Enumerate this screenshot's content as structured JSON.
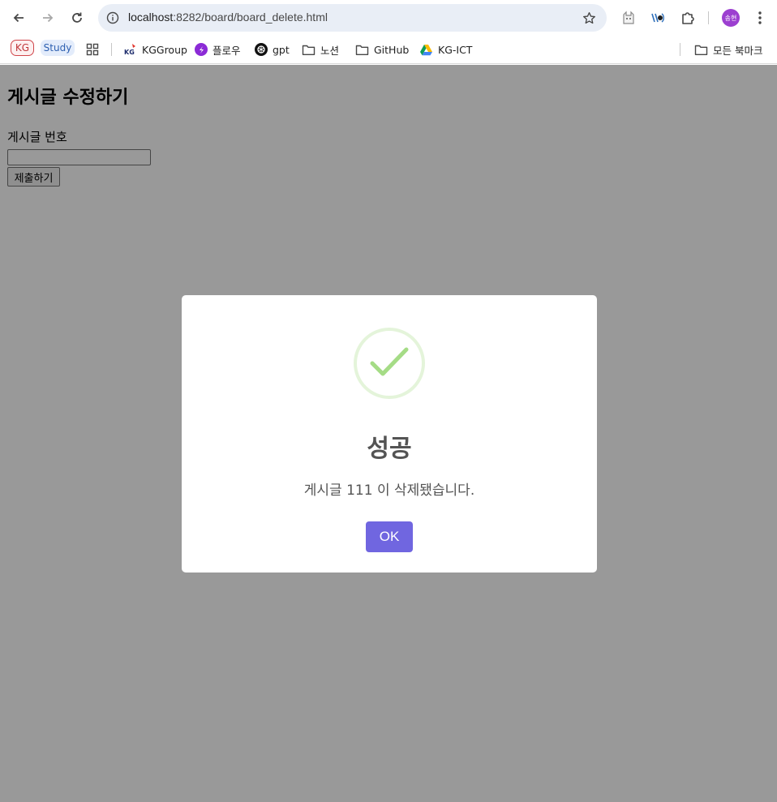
{
  "browser": {
    "url_host": "localhost",
    "url_rest": ":8282/board/board_delete.html",
    "profile_initials": "송현"
  },
  "bookmarks": {
    "kg_chip": "KG",
    "study_chip": "Study",
    "items": [
      "KGGroup",
      "플로우",
      "gpt",
      "노션",
      "GitHub",
      "KG-ICT"
    ],
    "all_bookmarks": "모든 북마크"
  },
  "page": {
    "heading": "게시글 수정하기",
    "label": "게시글 번호",
    "input_value": "",
    "submit_label": "제출하기"
  },
  "modal": {
    "title": "성공",
    "message": "게시글 111 이 삭제됐습니다.",
    "ok_label": "OK",
    "icon": "success-check-icon",
    "accent_color": "#7066e0",
    "check_color": "#a5dc86"
  }
}
